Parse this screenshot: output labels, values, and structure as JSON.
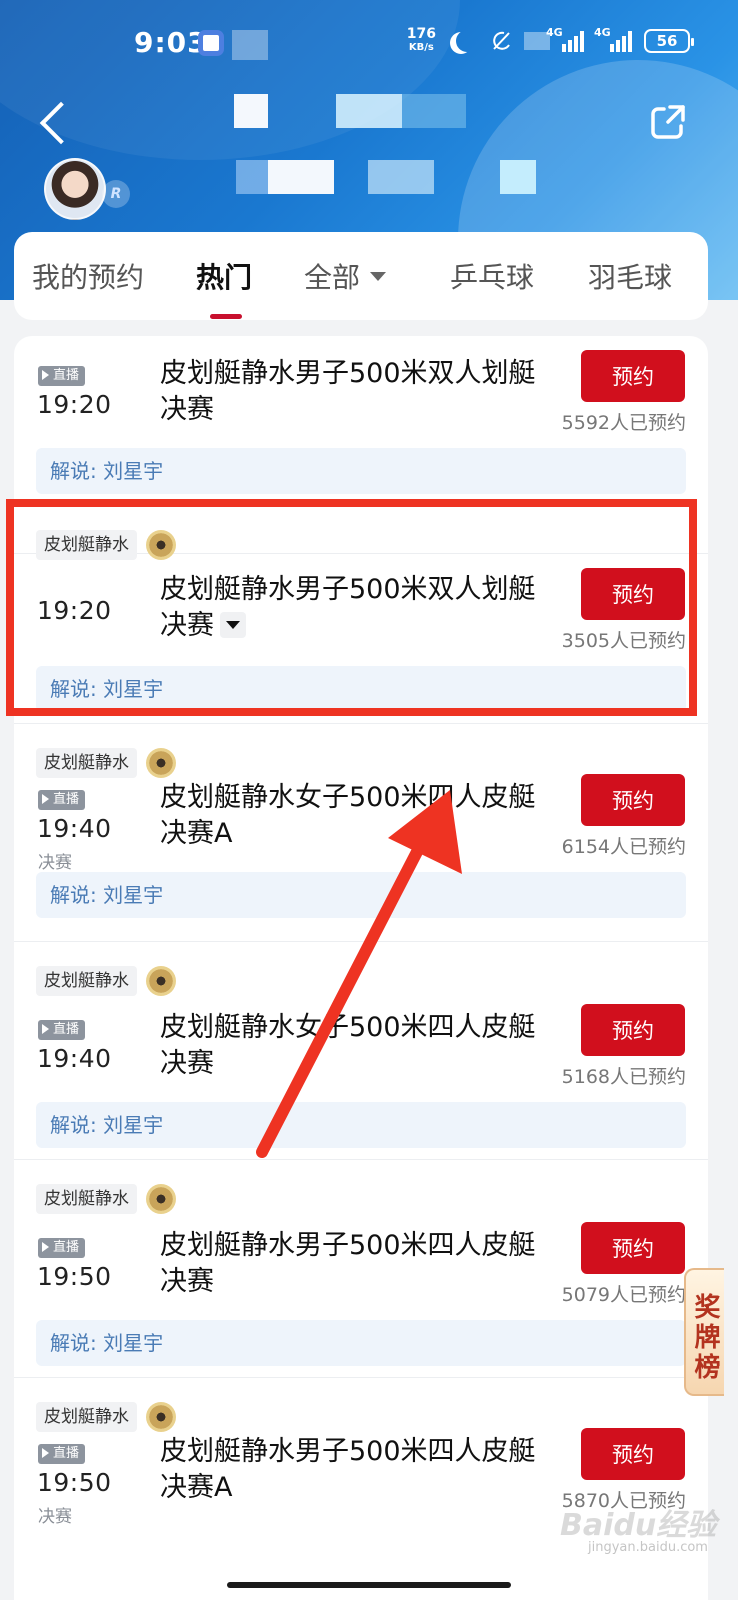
{
  "status_bar": {
    "time": "9:03",
    "speed_value": "176",
    "speed_unit": "KB/s",
    "net1": "4G",
    "net2": "4G",
    "battery": "56"
  },
  "tabs": [
    {
      "label": "我的预约",
      "active": false
    },
    {
      "label": "热门",
      "active": true
    },
    {
      "label": "全部",
      "active": false,
      "has_dropdown": true
    },
    {
      "label": "乒乓球",
      "active": false
    },
    {
      "label": "羽毛球",
      "active": false
    }
  ],
  "events": [
    {
      "sport_tag": "",
      "live_label": "直播",
      "time": "19:20",
      "stage": "",
      "title": "皮划艇静水男子500米双人划艇决赛",
      "button": "预约",
      "count": "5592人已预约",
      "commentary": "解说: 刘星宇"
    },
    {
      "sport_tag": "皮划艇静水",
      "live_label": "",
      "time": "19:20",
      "stage": "",
      "title": "皮划艇静水男子500米双人划艇决赛",
      "button": "预约",
      "count": "3505人已预约",
      "commentary": "解说: 刘星宇"
    },
    {
      "sport_tag": "皮划艇静水",
      "live_label": "直播",
      "time": "19:40",
      "stage": "决赛",
      "title": "皮划艇静水女子500米四人皮艇决赛A",
      "button": "预约",
      "count": "6154人已预约",
      "commentary": "解说: 刘星宇"
    },
    {
      "sport_tag": "皮划艇静水",
      "live_label": "直播",
      "time": "19:40",
      "stage": "",
      "title": "皮划艇静水女子500米四人皮艇决赛",
      "button": "预约",
      "count": "5168人已预约",
      "commentary": "解说: 刘星宇"
    },
    {
      "sport_tag": "皮划艇静水",
      "live_label": "直播",
      "time": "19:50",
      "stage": "",
      "title": "皮划艇静水男子500米四人皮艇决赛",
      "button": "预约",
      "count": "5079人已预约",
      "commentary": "解说: 刘星宇"
    },
    {
      "sport_tag": "皮划艇静水",
      "live_label": "直播",
      "time": "19:50",
      "stage": "决赛",
      "title": "皮划艇静水男子500米四人皮艇决赛A",
      "button": "预约",
      "count": "5870人已预约",
      "commentary": ""
    }
  ],
  "medal_tab": "奖牌榜",
  "watermark": "Baidu经验",
  "watermark_sub": "jingyan.baidu.com",
  "colors": {
    "header_blue": "#1a78d0",
    "reserve_red": "#d10f1d",
    "highlight_red": "#ee3322",
    "commentary_text": "#4a7bb5"
  },
  "icons": [
    "back-arrow-icon",
    "share-icon",
    "caret-down-icon",
    "play-icon",
    "medal-icon",
    "expand-caret-icon"
  ]
}
